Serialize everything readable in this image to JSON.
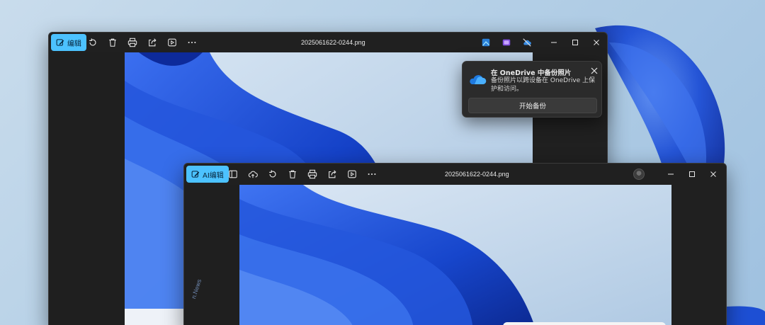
{
  "back_window": {
    "edit_label": "编辑",
    "file_name": "2025061622-0244.png"
  },
  "front_window": {
    "edit_label": "AI编辑",
    "file_name": "2025061622-0244.png"
  },
  "toast": {
    "title": "在 OneDrive 中备份照片",
    "body": "备份照片以跨设备在 OneDrive 上保护和访问。",
    "button_label": "开始备份"
  },
  "watermark": {
    "text": "n.News"
  },
  "colors": {
    "accent": "#4cc2ff",
    "titlebar": "#202020",
    "wallpaper_blue": "#1747c9"
  },
  "icons": {
    "back_toolbar": [
      "edit-icon",
      "rotate-icon",
      "delete-icon",
      "print-icon",
      "share-icon",
      "slideshow-icon",
      "more-icon"
    ],
    "front_toolbar": [
      "ai-edit-icon",
      "filmstrip-icon",
      "cloud-upload-icon",
      "rotate-icon",
      "delete-icon",
      "print-icon",
      "share-icon",
      "slideshow-icon",
      "more-icon"
    ]
  }
}
